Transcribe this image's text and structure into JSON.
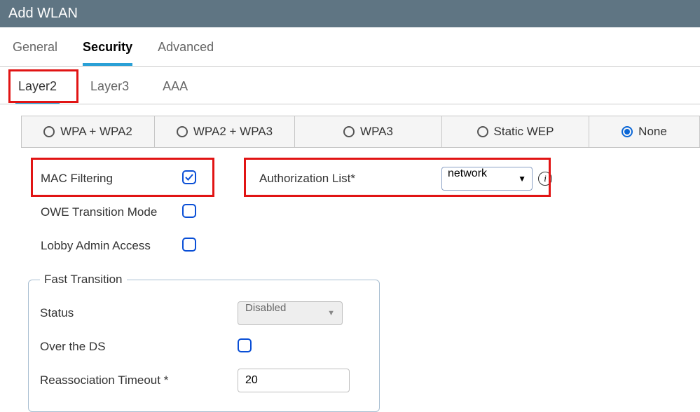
{
  "header": {
    "title": "Add WLAN"
  },
  "top_tabs": {
    "items": [
      {
        "label": "General",
        "active": false
      },
      {
        "label": "Security",
        "active": true
      },
      {
        "label": "Advanced",
        "active": false
      }
    ]
  },
  "sub_tabs": {
    "items": [
      {
        "label": "Layer2",
        "active": true
      },
      {
        "label": "Layer3",
        "active": false
      },
      {
        "label": "AAA",
        "active": false
      }
    ]
  },
  "security_modes": {
    "options": [
      {
        "label": "WPA + WPA2",
        "selected": false
      },
      {
        "label": "WPA2 + WPA3",
        "selected": false
      },
      {
        "label": "WPA3",
        "selected": false
      },
      {
        "label": "Static WEP",
        "selected": false
      },
      {
        "label": "None",
        "selected": true
      }
    ]
  },
  "mac_filtering": {
    "label": "MAC Filtering",
    "checked": true
  },
  "authorization_list": {
    "label": "Authorization List*",
    "value": "network"
  },
  "owe_transition": {
    "label": "OWE Transition Mode",
    "checked": false
  },
  "lobby_admin": {
    "label": "Lobby Admin Access",
    "checked": false
  },
  "fast_transition": {
    "legend": "Fast Transition",
    "status": {
      "label": "Status",
      "value": "Disabled"
    },
    "over_ds": {
      "label": "Over the DS",
      "checked": false
    },
    "reassoc_timeout": {
      "label": "Reassociation Timeout *",
      "value": "20"
    }
  }
}
